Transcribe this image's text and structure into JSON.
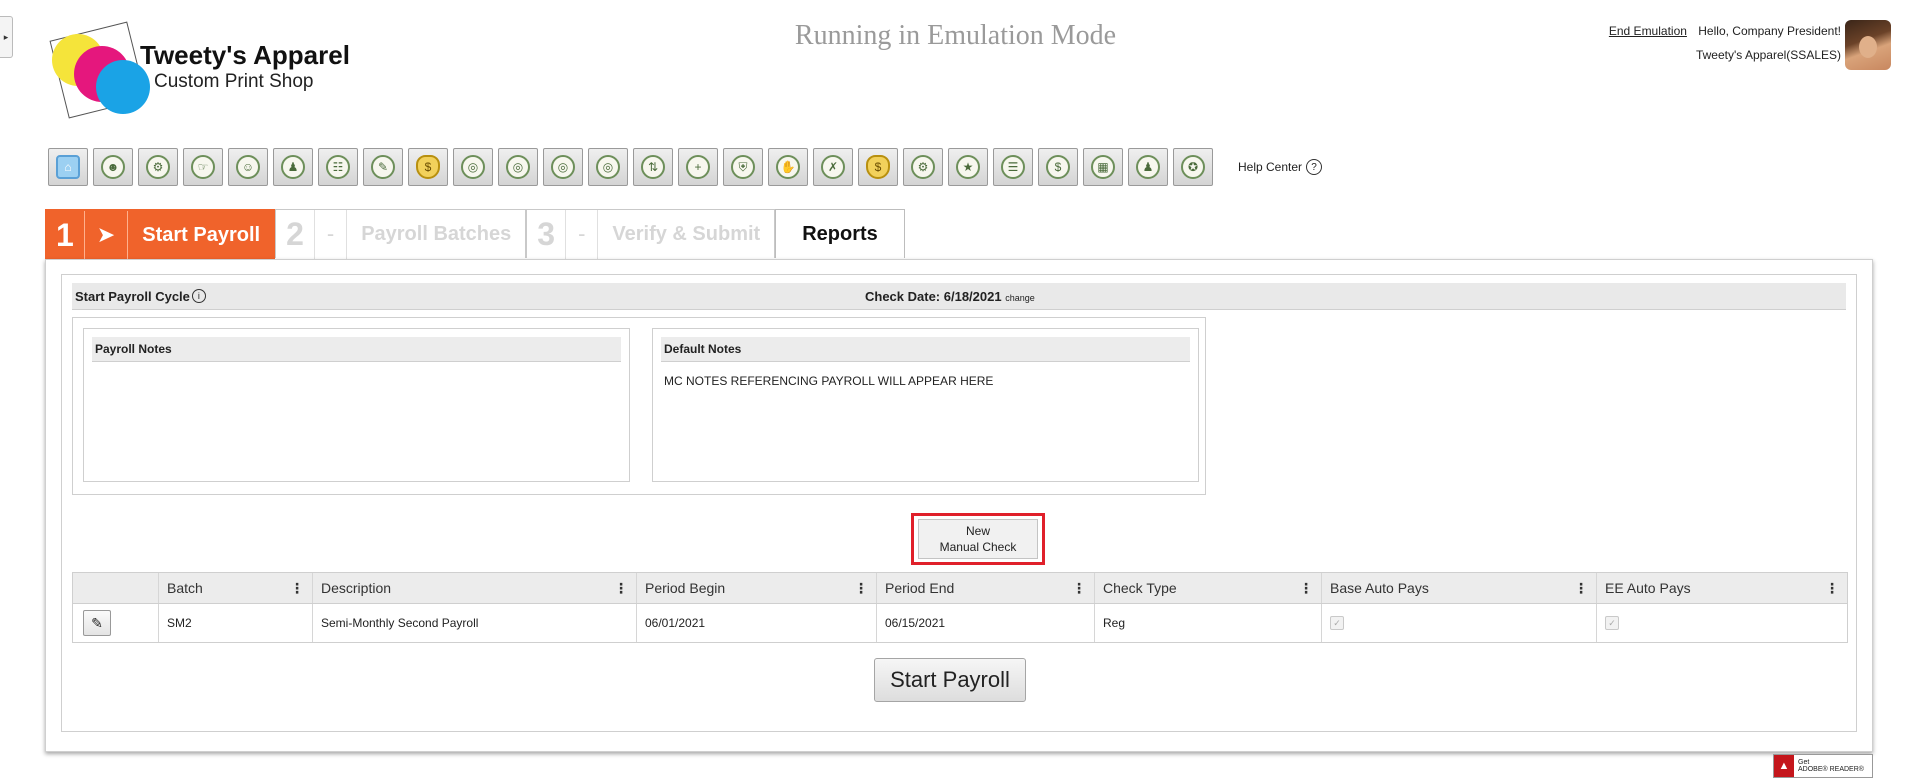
{
  "brand": {
    "name": "Tweety's Apparel",
    "tagline": "Custom Print Shop"
  },
  "emulation_title": "Running in Emulation Mode",
  "user": {
    "end_emulation": "End Emulation",
    "greeting": "Hello, Company President!",
    "company": "Tweety's Apparel(SSALES)"
  },
  "toolbar": {
    "icons": [
      "home-icon",
      "people-icon",
      "settings-people-icon",
      "hand-icon",
      "group-icon",
      "team-icon",
      "org-chart-icon",
      "document-icon",
      "money-bag-icon",
      "target-icon",
      "target-icon",
      "target-icon",
      "target-icon",
      "transfer-people-icon",
      "person-plus-icon",
      "shield-icon",
      "hand-money-icon",
      "person-remove-icon",
      "money-bag-icon",
      "team-settings-icon",
      "person-star-icon",
      "people-stack-icon",
      "hand-dollar-icon",
      "gift-icon",
      "team-icon",
      "certificate-icon"
    ],
    "help_center": "Help Center",
    "help_icon": "?"
  },
  "steps": [
    {
      "num": "1",
      "label": "Start Payroll"
    },
    {
      "num": "2",
      "dash": "-",
      "label": "Payroll Batches"
    },
    {
      "num": "3",
      "dash": "-",
      "label": "Verify & Submit"
    },
    {
      "label": "Reports"
    }
  ],
  "cycle": {
    "title": "Start Payroll Cycle",
    "info_icon": "i",
    "check_date": "Check Date: 6/18/2021",
    "change": "change"
  },
  "notes": {
    "payroll_title": "Payroll Notes",
    "payroll_body": "",
    "default_title": "Default Notes",
    "default_body": "MC NOTES REFERENCING PAYROLL WILL APPEAR HERE"
  },
  "manual_check": {
    "line1": "New",
    "line2": "Manual Check"
  },
  "grid": {
    "columns": [
      "Batch",
      "Description",
      "Period Begin",
      "Period End",
      "Check Type",
      "Base Auto Pays",
      "EE Auto Pays"
    ],
    "rows": [
      {
        "batch": "SM2",
        "description": "Semi-Monthly Second Payroll",
        "period_begin": "06/01/2021",
        "period_end": "06/15/2021",
        "check_type": "Reg",
        "base_auto_pays": true,
        "ee_auto_pays": true
      }
    ]
  },
  "start_button": "Start Payroll",
  "adobe": {
    "get": "Get",
    "reader": "ADOBE® READER®"
  }
}
